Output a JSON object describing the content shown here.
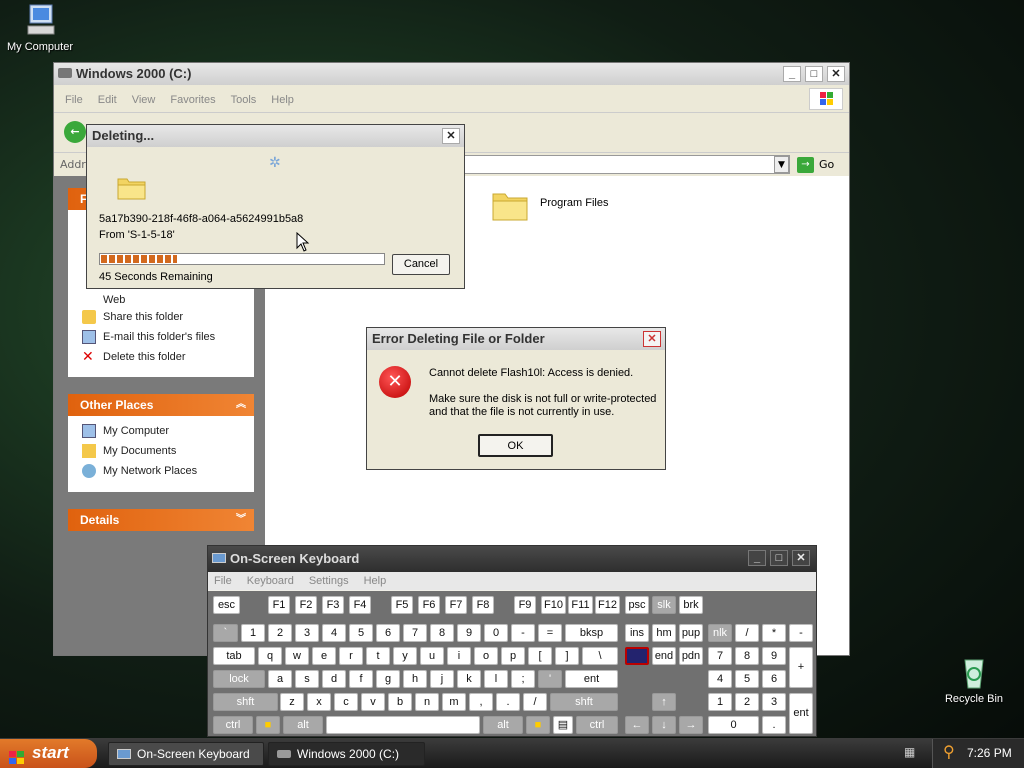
{
  "desktop": {
    "my_computer": "My Computer",
    "recycle_bin": "Recycle Bin"
  },
  "explorer": {
    "title": "Windows 2000 (C:)",
    "menu": [
      "File",
      "Edit",
      "View",
      "Favorites",
      "Tools",
      "Help"
    ],
    "address_label": "Addre",
    "go_label": "Go",
    "folder": "Program Files",
    "tasks": {
      "web": "Web",
      "share": "Share this folder",
      "email": "E-mail this folder's files",
      "delete": "Delete this folder"
    },
    "other_places": {
      "title": "Other Places",
      "items": [
        "My Computer",
        "My Documents",
        "My Network Places"
      ]
    },
    "details": {
      "title": "Details"
    },
    "tasks_head": "F"
  },
  "deleting": {
    "title": "Deleting...",
    "filename": "5a17b390-218f-46f8-a064-a5624991b5a8",
    "from": "From 'S-1-5-18'",
    "remaining": "45 Seconds Remaining",
    "cancel": "Cancel",
    "progress": 0.27
  },
  "error": {
    "title": "Error Deleting File or Folder",
    "message": "Cannot delete Flash10l: Access is denied.",
    "detail1": "Make sure the disk is not full or write-protected",
    "detail2": "and that the file is not currently in use.",
    "ok": "OK"
  },
  "osk": {
    "title": "On-Screen Keyboard",
    "menu": [
      "File",
      "Keyboard",
      "Settings",
      "Help"
    ],
    "keys": {
      "esc": "esc",
      "f1": "F1",
      "f2": "F2",
      "f3": "F3",
      "f4": "F4",
      "f5": "F5",
      "f6": "F6",
      "f7": "F7",
      "f8": "F8",
      "f9": "F9",
      "f10": "F10",
      "f11": "F11",
      "f12": "F12",
      "psc": "psc",
      "slk": "slk",
      "brk": "brk",
      "tick": "`",
      "n1": "1",
      "n2": "2",
      "n3": "3",
      "n4": "4",
      "n5": "5",
      "n6": "6",
      "n7": "7",
      "n8": "8",
      "n9": "9",
      "n0": "0",
      "minus": "-",
      "eq": "=",
      "bksp": "bksp",
      "ins": "ins",
      "hm": "hm",
      "pup": "pup",
      "nlk": "nlk",
      "slash": "/",
      "star": "*",
      "dash": "-",
      "tab": "tab",
      "q": "q",
      "w": "w",
      "e": "e",
      "r": "r",
      "t": "t",
      "y": "y",
      "u": "u",
      "i": "i",
      "o": "o",
      "p": "p",
      "lb": "[",
      "rb": "]",
      "bs": "\\",
      "end": "end",
      "pdn": "pdn",
      "p7": "7",
      "p8": "8",
      "p9": "9",
      "plus": "+",
      "lock": "lock",
      "a": "a",
      "s": "s",
      "d": "d",
      "f": "f",
      "g": "g",
      "h": "h",
      "j": "j",
      "k": "k",
      "l": "l",
      "semi": ";",
      "quote": "'",
      "ent": "ent",
      "p4": "4",
      "p5": "5",
      "p6": "6",
      "shft": "shft",
      "z": "z",
      "x": "x",
      "c": "c",
      "v": "v",
      "b": "b",
      "n": "n",
      "m": "m",
      "comma": ",",
      "dot": ".",
      "fslash": "/",
      "shft2": "shft",
      "up": "↑",
      "p1": "1",
      "p2": "2",
      "p3": "3",
      "ctrl": "ctrl",
      "alt": "alt",
      "alt2": "alt",
      "ctrl2": "ctrl",
      "left": "←",
      "down": "↓",
      "right": "→",
      "p0": "0",
      "pdot": ".",
      "pent": "ent"
    }
  },
  "taskbar": {
    "start": "start",
    "items": [
      "On-Screen Keyboard",
      "Windows 2000 (C:)"
    ],
    "clock": "7:26 PM"
  }
}
